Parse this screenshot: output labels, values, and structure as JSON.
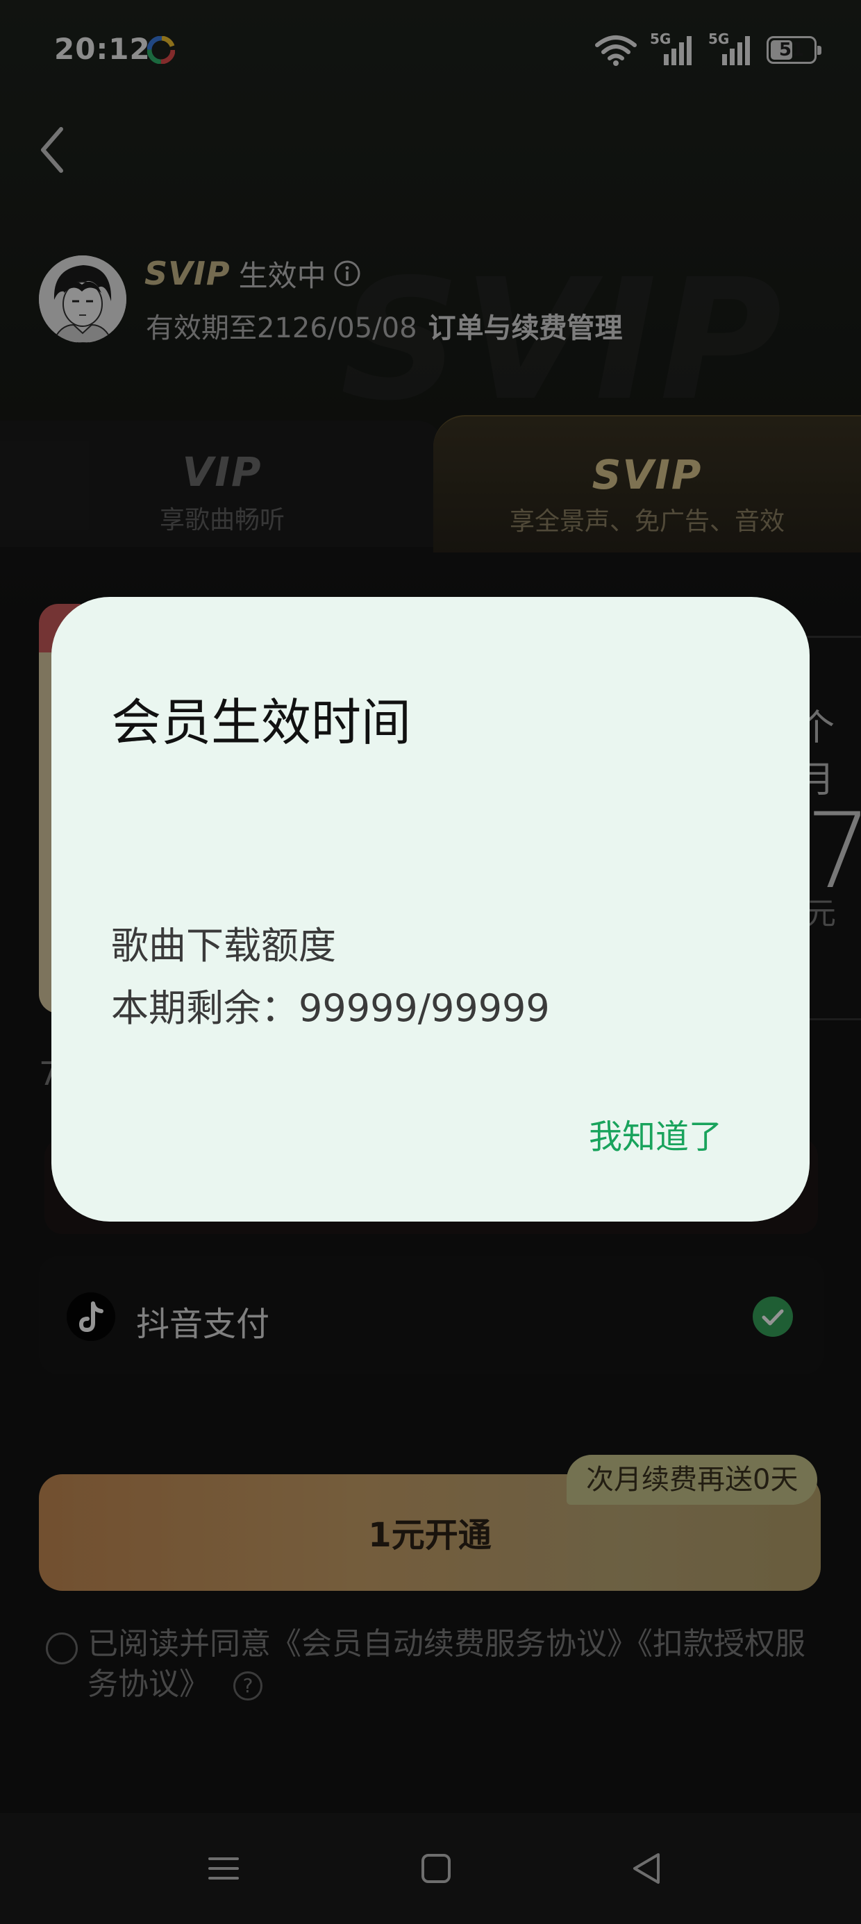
{
  "status_bar": {
    "time": "20:12",
    "network_1": "5G",
    "network_2": "5G",
    "battery": "51",
    "battery_level": 0.51
  },
  "header": {
    "membership_word": "SVIP",
    "membership_status": "生效中",
    "expiry_text": "有效期至2126/05/08",
    "order_link": "订单与续费管理",
    "watermark": "SVIP"
  },
  "tabs": [
    {
      "title": "VIP",
      "subtitle": "享歌曲畅听"
    },
    {
      "title": "SVIP",
      "subtitle": "享全景声、免广告、音效"
    }
  ],
  "background_card": {
    "month_fragment": "个月",
    "price_fragment": "7",
    "unit_fragment": "元",
    "left_fragment": "7"
  },
  "payment": {
    "method_label": "抖音支付",
    "selected": true
  },
  "cta": {
    "label": "1元开通",
    "badge": "次月续费再送0天"
  },
  "agreement": {
    "text": "已阅读并同意《会员自动续费服务协议》《扣款授权服务协议》",
    "help_glyph": "?"
  },
  "modal": {
    "title": "会员生效时间",
    "line1": "歌曲下载额度",
    "line2": "本期剩余：99999/99999",
    "confirm_label": "我知道了"
  },
  "colors": {
    "accent_green": "#19a35c",
    "gold": "#d9c48d",
    "modal_bg": "#eaf6f0"
  },
  "icons": {
    "back": "back-chevron-icon",
    "info": "info-icon",
    "douyin": "douyin-logo-icon",
    "check": "check-circle-icon",
    "nav_menu": "menu-icon",
    "nav_home": "home-square-icon",
    "nav_back": "back-triangle-icon"
  }
}
